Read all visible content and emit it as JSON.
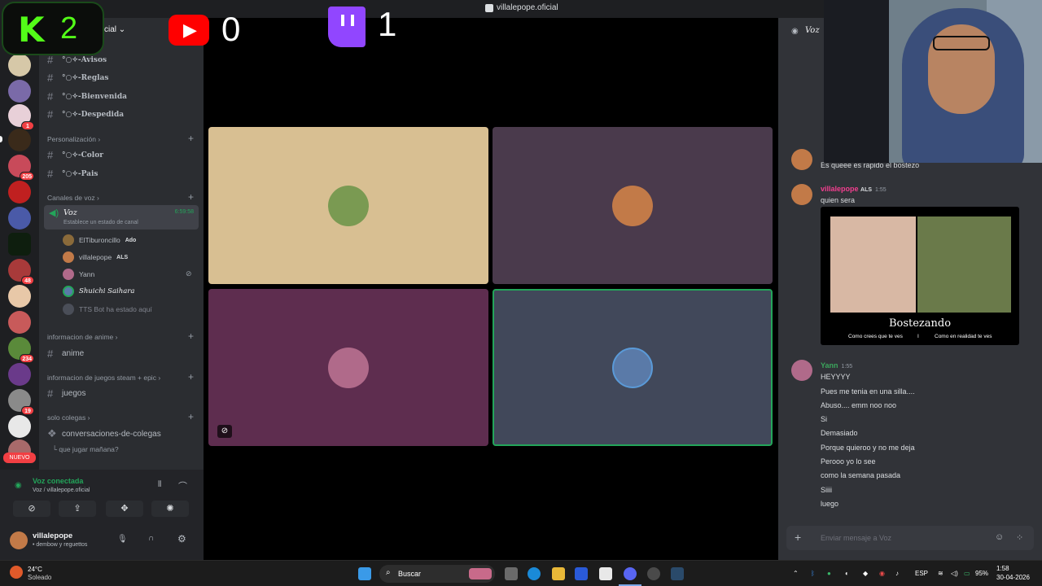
{
  "window": {
    "title": "villalepope.oficial"
  },
  "overlay": {
    "kick_count": "2",
    "youtube_count": "0",
    "twitch_count": "1",
    "server_name_fragment": "cial"
  },
  "servers": {
    "badges": [
      "1",
      "205",
      "48",
      "234",
      "19"
    ],
    "nuevo": "NUEVO"
  },
  "channels": {
    "top": [
      "°○✧-Avisos",
      "°○✧-Reglas",
      "°○✧-Bienvenida",
      "°○✧-Despedida"
    ],
    "personalizacion": {
      "label": "Personalización",
      "items": [
        "°○✧-Color",
        "°○✧-Pais"
      ]
    },
    "voz_category": {
      "label": "Canales de voz",
      "channel": "Voz",
      "timer": "6:59:58",
      "status_placeholder": "Establece un estado de canal"
    },
    "voice_users": [
      {
        "name": "ElTiburoncillo",
        "tag": "Ado"
      },
      {
        "name": "villalepope",
        "tag": "ALS"
      },
      {
        "name": "Yann",
        "tag": ""
      },
      {
        "name": "Shuichi Saihara",
        "tag": ""
      },
      {
        "name": "TTS Bot ha estado aquí",
        "tag": ""
      }
    ],
    "anime_category": {
      "label": "informacion de anime",
      "items": [
        "anime"
      ]
    },
    "juegos_category": {
      "label": "informacion de juegos steam + epic",
      "items": [
        "juegos"
      ]
    },
    "solo_category": {
      "label": "solo colegas",
      "forum": "conversaciones-de-colegas",
      "thread": "que jugar mañana?"
    }
  },
  "voice_panel": {
    "status": "Voz conectada",
    "location": "Voz / villalepope.oficial"
  },
  "user": {
    "name": "villalepope",
    "status": "• dembow y reguettos"
  },
  "stage": {
    "tiles": [
      {
        "bg": "#d8bf92",
        "avatar": "#7a9a52"
      },
      {
        "bg": "#4a3a4c",
        "avatar": "#c27a48"
      },
      {
        "bg": "#5e2d4f",
        "avatar": "#b06a8a"
      },
      {
        "bg": "#41485a",
        "avatar": "#5a7aa8"
      }
    ],
    "speaking_border": "#23a55a"
  },
  "chat": {
    "header": "Voz",
    "first_line": "Es queee es rapido el bostezo",
    "msg1": {
      "user": "villalepope",
      "tag": "ALS",
      "time": "1:55",
      "lines": [
        "quien sera"
      ]
    },
    "meme": {
      "title": "Bostezando",
      "left_caption": "Como crees que te ves",
      "right_caption": "Como en realidad te ves",
      "divider": "I"
    },
    "msg2": {
      "user": "Yann",
      "time": "1:55",
      "lines": [
        "HEYYYY",
        "Pues me tenia en una silla....",
        "Abuso.... emm noo noo",
        "Si",
        "Demasiado",
        "Porque quieroo y no me deja",
        "Perooo yo lo see",
        "como la semana pasada",
        "Siiii",
        "luego"
      ]
    },
    "input_placeholder": "Enviar mensaje a Voz"
  },
  "taskbar": {
    "weather_temp": "24°C",
    "weather_desc": "Soleado",
    "search": "Buscar",
    "lang": "ESP",
    "battery": "95%",
    "time": "1:58",
    "date": "30-04-2026"
  },
  "colors": {
    "kick": "#53fc18",
    "youtube": "#ff0000",
    "twitch": "#9146ff",
    "discord_green": "#23a55a",
    "villalepope_name": "#f23f8f",
    "yann_name": "#3ba55c"
  }
}
